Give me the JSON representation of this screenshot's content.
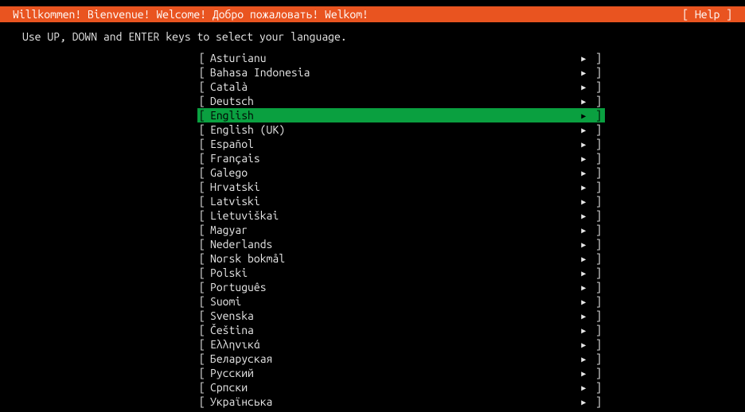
{
  "header": {
    "title": "Willkommen! Bienvenue! Welcome! Добро пожаловать! Welkom!",
    "help": "[ Help ]"
  },
  "instruction": "Use UP, DOWN and ENTER keys to select your language.",
  "selected_index": 4,
  "languages": [
    "Asturianu",
    "Bahasa Indonesia",
    "Català",
    "Deutsch",
    "English",
    "English (UK)",
    "Español",
    "Français",
    "Galego",
    "Hrvatski",
    "Latviski",
    "Lietuviškai",
    "Magyar",
    "Nederlands",
    "Norsk bokmål",
    "Polski",
    "Português",
    "Suomi",
    "Svenska",
    "Čeština",
    "Ελληνικά",
    "Беларуская",
    "Русский",
    "Српски",
    "Українська"
  ]
}
